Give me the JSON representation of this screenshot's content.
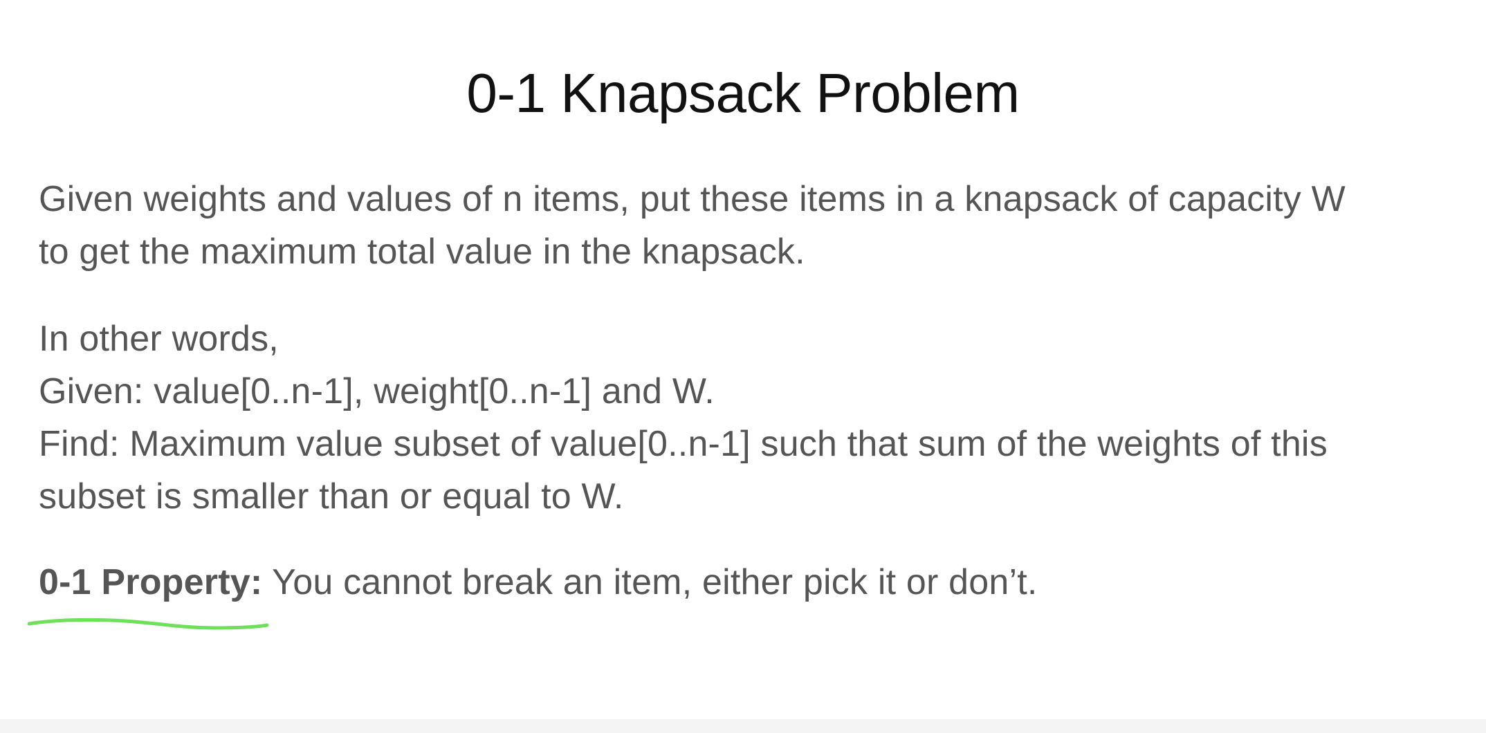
{
  "slide": {
    "title": "0-1 Knapsack Problem",
    "paragraph1": {
      "line1": "Given weights and values of n items, put these items in a knapsack of capacity W",
      "line2": "to get the maximum total value in the knapsack."
    },
    "paragraph2": {
      "line1": "In other words,",
      "line2": "Given: value[0..n-1], weight[0..n-1] and W.",
      "line3": "Find: Maximum value subset of value[0..n-1] such that sum of the weights of this",
      "line4": "subset is smaller than or equal to W."
    },
    "property": {
      "label": "0-1 Property:",
      "text": " You cannot break an item, either pick it or don’t."
    }
  },
  "colors": {
    "title": "#111111",
    "body": "#555555",
    "highlight_underline": "#6ee05a"
  }
}
